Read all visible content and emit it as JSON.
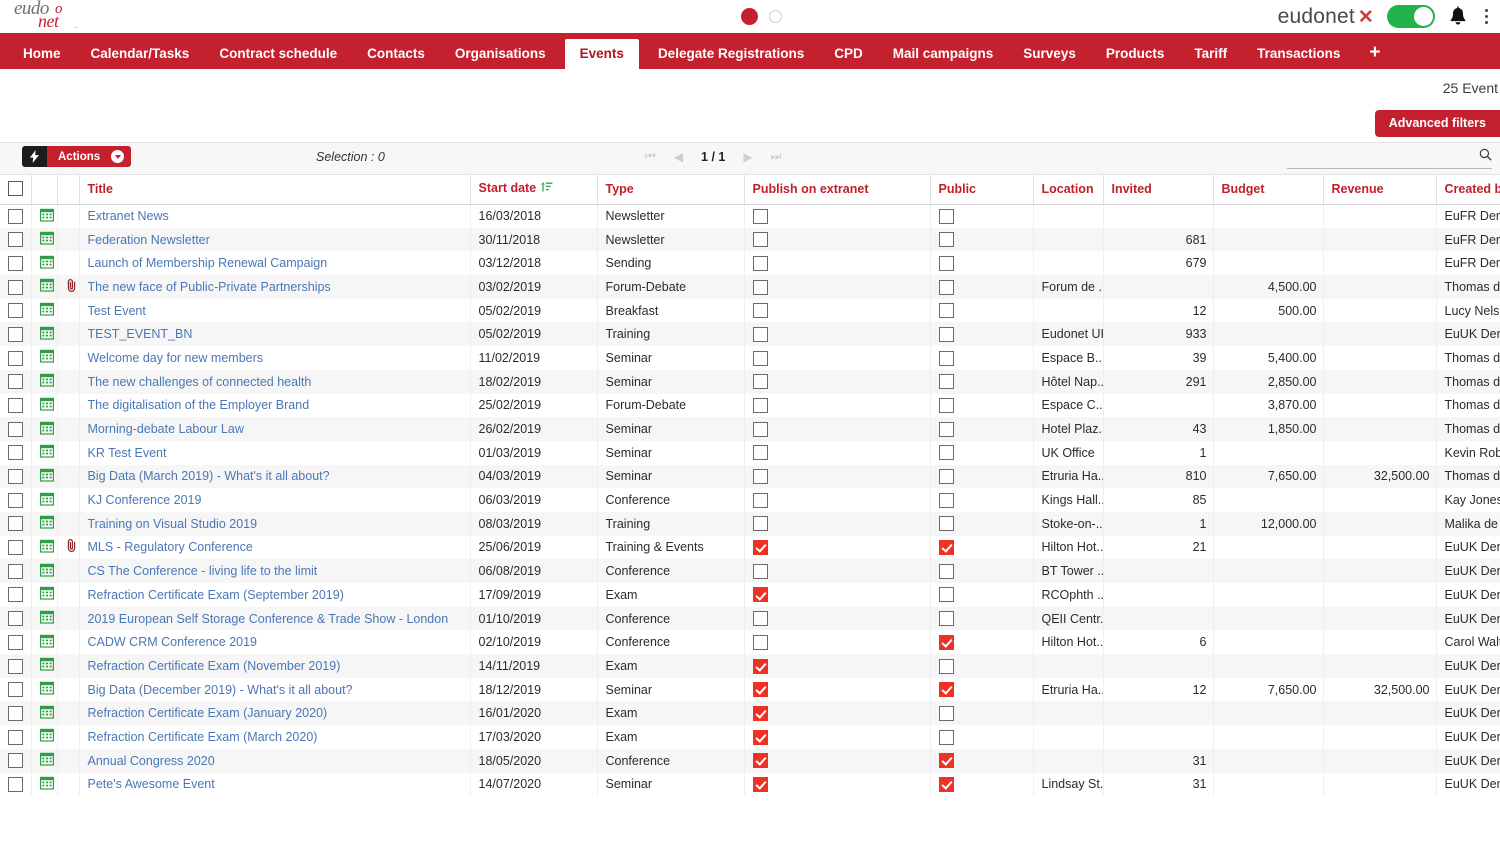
{
  "brand": {
    "logo_line1": "eudo",
    "logo_o": "o",
    "logo_net": "net",
    "logo_dots": "..",
    "word": "eudonet",
    "word_mark": "✕"
  },
  "header": {
    "toggle_state": "on",
    "bell_icon": "bell-icon",
    "menu_icon": "kebab-menu-icon",
    "indicator_filled": "filled-red-dot",
    "indicator_empty": "empty-circle"
  },
  "nav": {
    "items": [
      {
        "label": "Home",
        "active": false
      },
      {
        "label": "Calendar/Tasks",
        "active": false
      },
      {
        "label": "Contract schedule",
        "active": false
      },
      {
        "label": "Contacts",
        "active": false
      },
      {
        "label": "Organisations",
        "active": false
      },
      {
        "label": "Events",
        "active": true
      },
      {
        "label": "Delegate Registrations",
        "active": false
      },
      {
        "label": "CPD",
        "active": false
      },
      {
        "label": "Mail campaigns",
        "active": false
      },
      {
        "label": "Surveys",
        "active": false
      },
      {
        "label": "Products",
        "active": false
      },
      {
        "label": "Tariff",
        "active": false
      },
      {
        "label": "Transactions",
        "active": false
      }
    ],
    "add_tab": "+"
  },
  "subheader": {
    "record_count": "25 Event",
    "advanced_filters": "Advanced filters"
  },
  "toolbar": {
    "actions_label": "Actions",
    "flash_icon": "lightning-icon",
    "caret_icon": "chevron-down-icon",
    "selection": "Selection : 0",
    "page_label": "1 / 1",
    "first_page": "⏮",
    "prev_page": "◀",
    "next_page": "▶",
    "last_page": "⏭",
    "search_value": "",
    "search_placeholder": "",
    "search_icon": "search-icon"
  },
  "table": {
    "select_all": false,
    "columns": [
      {
        "key": "title",
        "label": "Title"
      },
      {
        "key": "date",
        "label": "Start date",
        "sorted": "asc"
      },
      {
        "key": "type",
        "label": "Type"
      },
      {
        "key": "publish",
        "label": "Publish on extranet"
      },
      {
        "key": "public",
        "label": "Public"
      },
      {
        "key": "loc",
        "label": "Location"
      },
      {
        "key": "inv",
        "label": "Invited"
      },
      {
        "key": "bud",
        "label": "Budget"
      },
      {
        "key": "rev",
        "label": "Revenue"
      },
      {
        "key": "by",
        "label": "Created by"
      }
    ],
    "rows": [
      {
        "title": "Extranet News",
        "date": "16/03/2018",
        "type": "Newsletter",
        "publish": false,
        "public": false,
        "loc": "",
        "inv": "",
        "bud": "",
        "rev": "",
        "by": "EuFR Dem",
        "clip": false
      },
      {
        "title": "Federation Newsletter",
        "date": "30/11/2018",
        "type": "Newsletter",
        "publish": false,
        "public": false,
        "loc": "",
        "inv": "681",
        "bud": "",
        "rev": "",
        "by": "EuFR Dem",
        "clip": false
      },
      {
        "title": "Launch of Membership Renewal Campaign",
        "date": "03/12/2018",
        "type": "Sending",
        "publish": false,
        "public": false,
        "loc": "",
        "inv": "679",
        "bud": "",
        "rev": "",
        "by": "EuFR Dem",
        "clip": false
      },
      {
        "title": "The new face of Public-Private Partnerships",
        "date": "03/02/2019",
        "type": "Forum-Debate",
        "publish": false,
        "public": false,
        "loc": "Forum de ...",
        "inv": "",
        "bud": "4,500.00",
        "rev": "",
        "by": "Thomas d",
        "clip": true
      },
      {
        "title": "Test Event",
        "date": "05/02/2019",
        "type": "Breakfast",
        "publish": false,
        "public": false,
        "loc": "",
        "inv": "12",
        "bud": "500.00",
        "rev": "",
        "by": "Lucy Nels",
        "clip": false
      },
      {
        "title": "TEST_EVENT_BN",
        "date": "05/02/2019",
        "type": "Training",
        "publish": false,
        "public": false,
        "loc": "Eudonet UK",
        "inv": "933",
        "bud": "",
        "rev": "",
        "by": "EuUK Dem",
        "clip": false
      },
      {
        "title": "Welcome day for new members",
        "date": "11/02/2019",
        "type": "Seminar",
        "publish": false,
        "public": false,
        "loc": "Espace B...",
        "inv": "39",
        "bud": "5,400.00",
        "rev": "",
        "by": "Thomas d",
        "clip": false
      },
      {
        "title": "The new challenges of connected health",
        "date": "18/02/2019",
        "type": "Seminar",
        "publish": false,
        "public": false,
        "loc": "Hôtel Nap...",
        "inv": "291",
        "bud": "2,850.00",
        "rev": "",
        "by": "Thomas d",
        "clip": false
      },
      {
        "title": "The digitalisation of the Employer Brand",
        "date": "25/02/2019",
        "type": "Forum-Debate",
        "publish": false,
        "public": false,
        "loc": "Espace C...",
        "inv": "",
        "bud": "3,870.00",
        "rev": "",
        "by": "Thomas d",
        "clip": false
      },
      {
        "title": "Morning-debate Labour Law",
        "date": "26/02/2019",
        "type": "Seminar",
        "publish": false,
        "public": false,
        "loc": "Hotel Plaz...",
        "inv": "43",
        "bud": "1,850.00",
        "rev": "",
        "by": "Thomas d",
        "clip": false
      },
      {
        "title": "KR Test Event",
        "date": "01/03/2019",
        "type": "Seminar",
        "publish": false,
        "public": false,
        "loc": "UK Office",
        "inv": "1",
        "bud": "",
        "rev": "",
        "by": "Kevin Rob",
        "clip": false
      },
      {
        "title": "Big Data (March 2019) - What's it all about?",
        "date": "04/03/2019",
        "type": "Seminar",
        "publish": false,
        "public": false,
        "loc": "Etruria Ha...",
        "inv": "810",
        "bud": "7,650.00",
        "rev": "32,500.00",
        "by": "Thomas d",
        "clip": false
      },
      {
        "title": "KJ Conference 2019",
        "date": "06/03/2019",
        "type": "Conference",
        "publish": false,
        "public": false,
        "loc": "Kings Hall...",
        "inv": "85",
        "bud": "",
        "rev": "",
        "by": "Kay Jones",
        "clip": false
      },
      {
        "title": "Training on Visual Studio 2019",
        "date": "08/03/2019",
        "type": "Training",
        "publish": false,
        "public": false,
        "loc": "Stoke-on-...",
        "inv": "1",
        "bud": "12,000.00",
        "rev": "",
        "by": "Malika de",
        "clip": false
      },
      {
        "title": "MLS - Regulatory Conference",
        "date": "25/06/2019",
        "type": "Training & Events",
        "publish": true,
        "public": true,
        "loc": "Hilton Hot...",
        "inv": "21",
        "bud": "",
        "rev": "",
        "by": "EuUK Dem",
        "clip": true
      },
      {
        "title": "CS The Conference - living life to the limit",
        "date": "06/08/2019",
        "type": "Conference",
        "publish": false,
        "public": false,
        "loc": "BT Tower ...",
        "inv": "",
        "bud": "",
        "rev": "",
        "by": "EuUK Dem",
        "clip": false
      },
      {
        "title": "Refraction Certificate Exam (September 2019)",
        "date": "17/09/2019",
        "type": "Exam",
        "publish": true,
        "public": false,
        "loc": "RCOphth ...",
        "inv": "",
        "bud": "",
        "rev": "",
        "by": "EuUK Dem",
        "clip": false
      },
      {
        "title": "2019 European Self Storage Conference & Trade Show - London",
        "date": "01/10/2019",
        "type": "Conference",
        "publish": false,
        "public": false,
        "loc": "QEII Centr...",
        "inv": "",
        "bud": "",
        "rev": "",
        "by": "EuUK Dem",
        "clip": false
      },
      {
        "title": "CADW CRM Conference 2019",
        "date": "02/10/2019",
        "type": "Conference",
        "publish": false,
        "public": true,
        "loc": "Hilton Hot...",
        "inv": "6",
        "bud": "",
        "rev": "",
        "by": "Carol Walt",
        "clip": false
      },
      {
        "title": "Refraction Certificate Exam (November 2019)",
        "date": "14/11/2019",
        "type": "Exam",
        "publish": true,
        "public": false,
        "loc": "",
        "inv": "",
        "bud": "",
        "rev": "",
        "by": "EuUK Dem",
        "clip": false
      },
      {
        "title": "Big Data (December 2019) - What's it all about?",
        "date": "18/12/2019",
        "type": "Seminar",
        "publish": true,
        "public": true,
        "loc": "Etruria Ha...",
        "inv": "12",
        "bud": "7,650.00",
        "rev": "32,500.00",
        "by": "EuUK Dem",
        "clip": false
      },
      {
        "title": "Refraction Certificate Exam (January 2020)",
        "date": "16/01/2020",
        "type": "Exam",
        "publish": true,
        "public": false,
        "loc": "",
        "inv": "",
        "bud": "",
        "rev": "",
        "by": "EuUK Dem",
        "clip": false
      },
      {
        "title": "Refraction Certificate Exam (March 2020)",
        "date": "17/03/2020",
        "type": "Exam",
        "publish": true,
        "public": false,
        "loc": "",
        "inv": "",
        "bud": "",
        "rev": "",
        "by": "EuUK Dem",
        "clip": false
      },
      {
        "title": "Annual Congress 2020",
        "date": "18/05/2020",
        "type": "Conference",
        "publish": true,
        "public": true,
        "loc": "",
        "inv": "31",
        "bud": "",
        "rev": "",
        "by": "EuUK Dem",
        "clip": false
      },
      {
        "title": "Pete's Awesome Event",
        "date": "14/07/2020",
        "type": "Seminar",
        "publish": true,
        "public": true,
        "loc": "Lindsay St...",
        "inv": "31",
        "bud": "",
        "rev": "",
        "by": "EuUK Dem",
        "clip": false
      }
    ]
  },
  "colors": {
    "brand_red": "#c5202e",
    "check_red": "#ee3124",
    "link_blue": "#4a77b5",
    "toggle_green": "#22b24c",
    "calendar_green": "#2f9e44"
  }
}
